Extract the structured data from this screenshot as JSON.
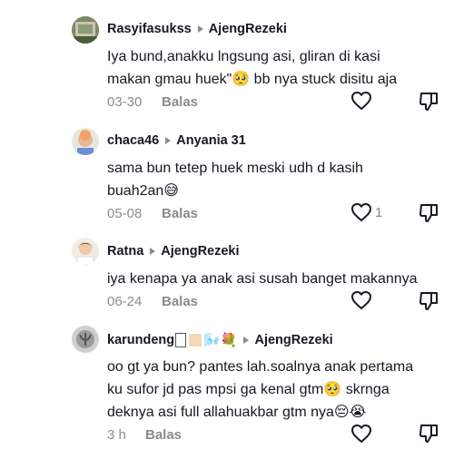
{
  "comments": [
    {
      "username": "Rasyifasukss",
      "reply_to": "AjengRezeki",
      "text": "Iya bund,anakku lngsung asi, gliran di kasi\nmakan gmau huek\"🥺 bb nya stuck disitu aja",
      "time": "03-30",
      "reply_label": "Balas",
      "likes": ""
    },
    {
      "username": "chaca46",
      "reply_to": "Anyania 31",
      "text": "sama bun tetep huek meski udh d kasih\nbuah2an😅",
      "time": "05-08",
      "reply_label": "Balas",
      "likes": "1"
    },
    {
      "username": "Ratna",
      "reply_to": "AjengRezeki",
      "text": "iya kenapa ya anak asi susah banget makannya",
      "time": "06-24",
      "reply_label": "Balas",
      "likes": ""
    },
    {
      "username": "karundeng",
      "username_suffix": "🌬️💐",
      "reply_to": "AjengRezeki",
      "text": "oo gt ya bun? pantes lah.soalnya anak pertama\nku sufor jd pas mpsi ga kenal gtm🥺 skrnga\ndeknya asi full allahuakbar gtm nya😔😭",
      "time": "3 h",
      "reply_label": "Balas",
      "likes": ""
    }
  ],
  "icons": {
    "like": "heart-outline-icon",
    "dislike": "thumbs-down-outline-icon",
    "reply_arrow": "play-triangle-icon"
  },
  "colors": {
    "text": "#161823",
    "secondary": "#8a8b91",
    "background": "#ffffff"
  }
}
